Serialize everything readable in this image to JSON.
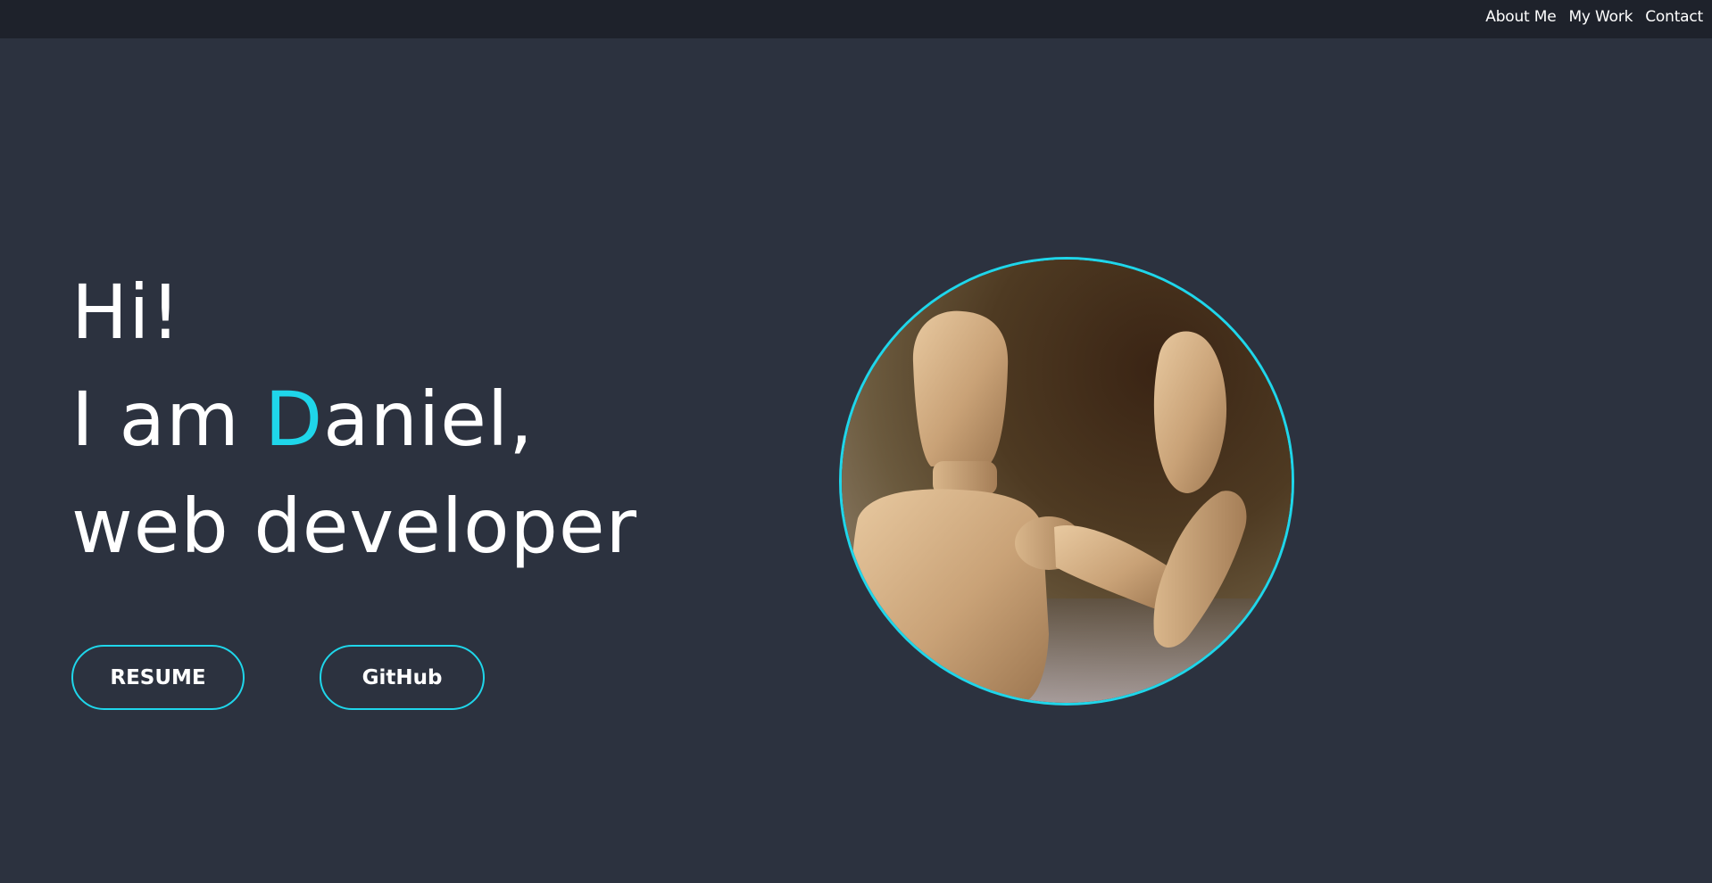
{
  "nav": {
    "items": [
      {
        "label": "About Me"
      },
      {
        "label": "My Work"
      },
      {
        "label": "Contact"
      }
    ]
  },
  "hero": {
    "greeting": "Hi!",
    "intro_prefix": "I am ",
    "name_initial": "D",
    "name_rest": "aniel,",
    "role": "web developer"
  },
  "buttons": {
    "resume": "RESUME",
    "github": "GitHub"
  },
  "colors": {
    "background": "#2c323f",
    "topbar": "#1e222b",
    "accent": "#1fd6ea",
    "text": "#ffffff"
  },
  "portrait": {
    "subject": "wooden-mannequin-waving"
  }
}
